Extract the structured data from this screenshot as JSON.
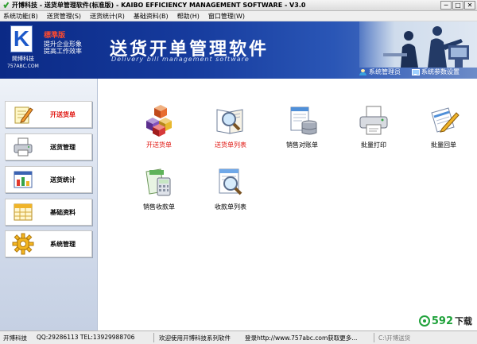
{
  "window": {
    "title": "开博科技 - 送货单管理软件(标准版) - KAIBO EFFICIENCY MANAGEMENT SOFTWARE - V3.0",
    "minimize": "─",
    "maximize": "□",
    "close": "✕"
  },
  "menu": [
    "系统功能(B)",
    "送货管理(S)",
    "送货统计(R)",
    "基础资料(B)",
    "帮助(H)",
    "窗口管理(W)"
  ],
  "header": {
    "logo_letter": "K",
    "logo_company": "開博科技",
    "logo_url": "757ABC.COM",
    "edition": "標準版",
    "slogan_line1": "提升企业形象",
    "slogan_line2": "提高工作效率",
    "title": "送货开单管理软件",
    "subtitle": "Delivery bill management software",
    "user_link": "系统管理员",
    "settings_link": "系统参数设置"
  },
  "sidebar": [
    {
      "label": "开送货单",
      "icon": "pencil-note-icon",
      "active": true
    },
    {
      "label": "送货管理",
      "icon": "printer-icon",
      "active": false
    },
    {
      "label": "送货统计",
      "icon": "bar-chart-icon",
      "active": false
    },
    {
      "label": "基础资料",
      "icon": "calendar-grid-icon",
      "active": false
    },
    {
      "label": "系统管理",
      "icon": "gear-icon",
      "active": false
    }
  ],
  "tiles": [
    {
      "label": "开送货单",
      "icon": "cubes-icon",
      "red": true
    },
    {
      "label": "送货单列表",
      "icon": "magnifier-book-icon",
      "red": true
    },
    {
      "label": "销售对账单",
      "icon": "database-document-icon",
      "red": false
    },
    {
      "label": "批量打印",
      "icon": "printer-icon",
      "red": false
    },
    {
      "label": "批量回单",
      "icon": "pencil-document-icon",
      "red": false
    },
    {
      "label": "销售收款单",
      "icon": "calculator-document-icon",
      "red": false
    },
    {
      "label": "收款单列表",
      "icon": "magnifier-document-icon",
      "red": false
    }
  ],
  "status": {
    "company": "开博科技",
    "contact": "QQ:29286113 TEL:13929988706",
    "welcome": "欢迎使用开博科技系列软件",
    "website": "登录http://www.757abc.com获取更多...",
    "path": "C:\\开博送货"
  },
  "watermark": {
    "number": "592",
    "text": "下载"
  },
  "colors": {
    "accent_red": "#e0150f",
    "banner_blue": "#0b2a86",
    "watermark_green": "#20a23b"
  }
}
